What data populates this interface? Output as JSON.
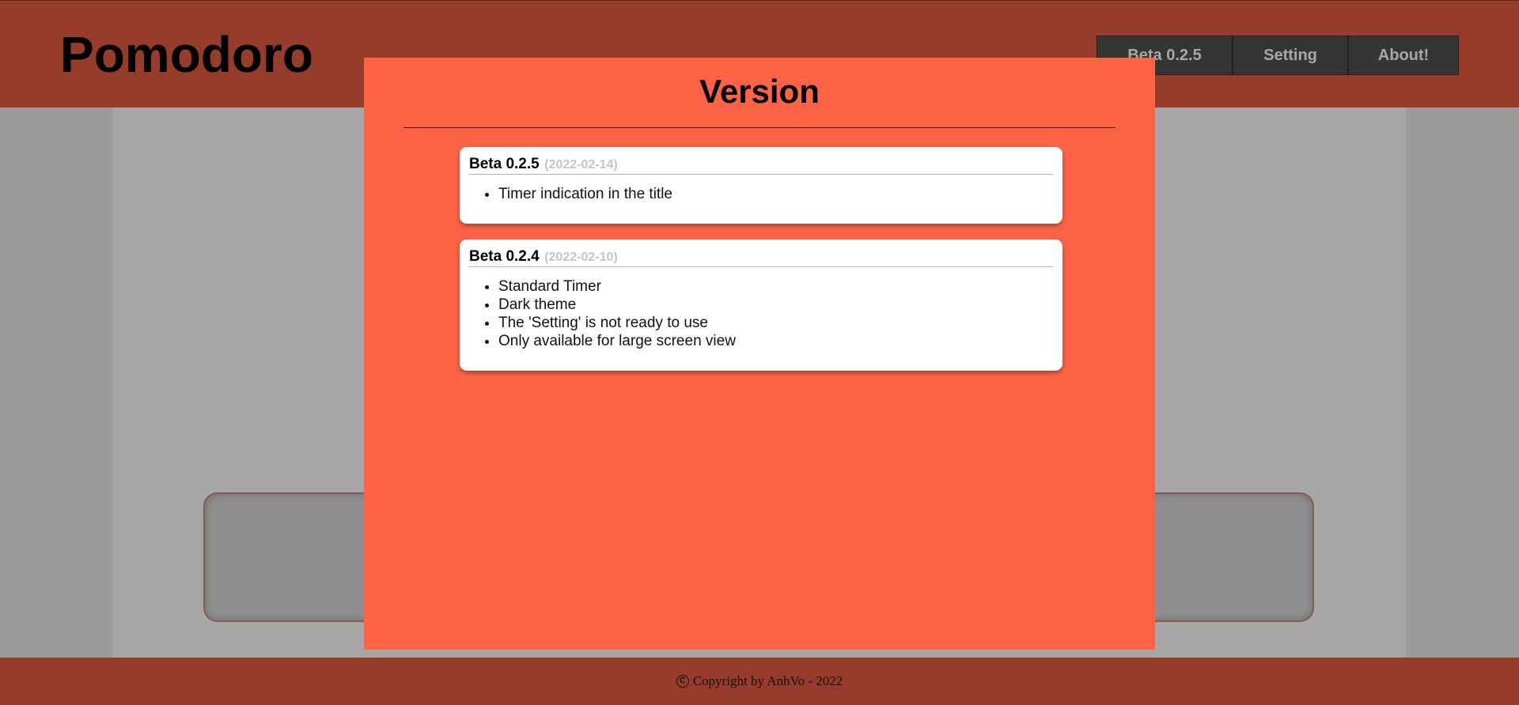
{
  "header": {
    "title": "Pomodoro",
    "nav": [
      {
        "label": "Beta 0.2.5"
      },
      {
        "label": "Setting"
      },
      {
        "label": "About!"
      }
    ]
  },
  "modal": {
    "title": "Version",
    "versions": [
      {
        "name": "Beta 0.2.5",
        "date": "(2022-02-14)",
        "notes": [
          "Timer indication in the title"
        ]
      },
      {
        "name": "Beta 0.2.4",
        "date": "(2022-02-10)",
        "notes": [
          "Standard Timer",
          "Dark theme",
          "The 'Setting' is not ready to use",
          "Only available for large screen view"
        ]
      }
    ]
  },
  "footer": {
    "copyright_symbol": "C",
    "text": "Copyright by AnhVo - 2022"
  },
  "colors": {
    "header_bg": "#973b2a",
    "modal_bg": "#ff6346",
    "overlay_bg": "#9a9a9a",
    "nav_bg": "#353535"
  }
}
